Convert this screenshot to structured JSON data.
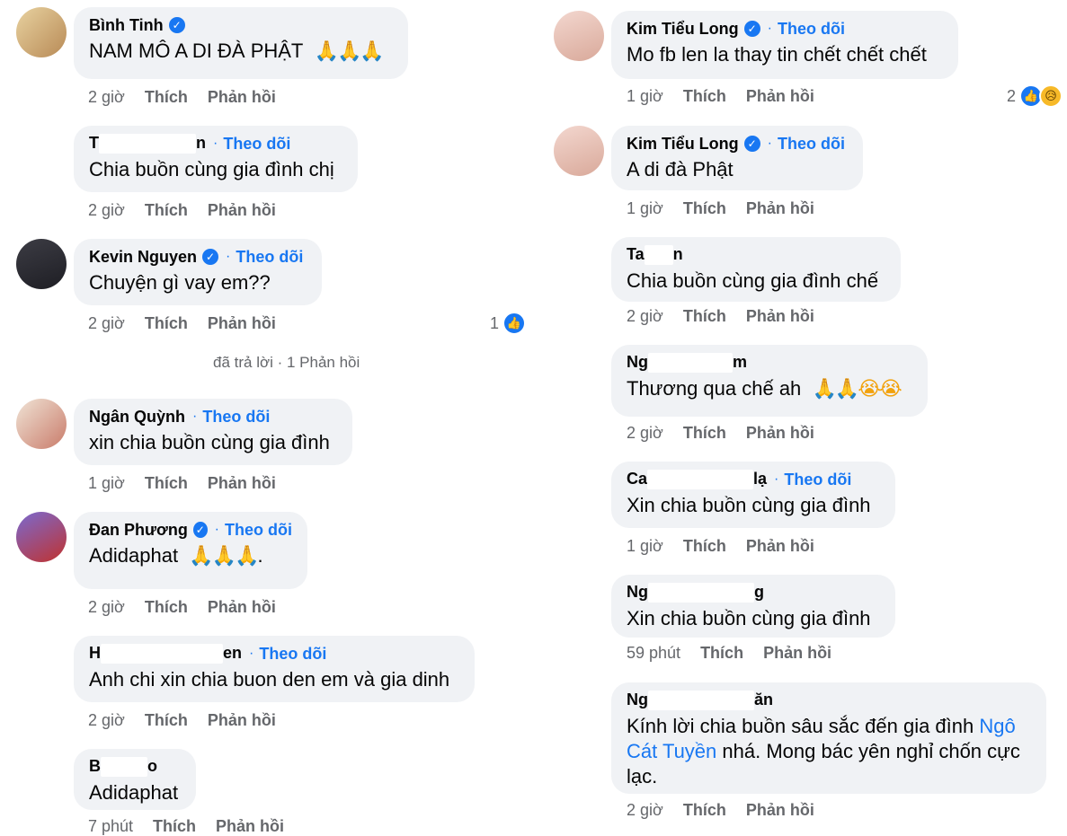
{
  "left": [
    {
      "name": "Bình Tinh",
      "verified": true,
      "follow": "",
      "text": "NAM MÔ A DI ĐÀ PHẬT",
      "emoji": "🙏🙏🙏",
      "time": "2 giờ",
      "like": "Thích",
      "reply": "Phản hồi"
    },
    {
      "name_pre": "T",
      "name_post": "n",
      "follow": "Theo dõi",
      "text": "Chia buồn cùng gia đình chị",
      "time": "2 giờ",
      "like": "Thích",
      "reply": "Phản hồi"
    },
    {
      "name": "Kevin Nguyen",
      "verified": true,
      "follow": "Theo dõi",
      "text": "Chuyện gì vay em??",
      "time": "2 giờ",
      "like": "Thích",
      "reply": "Phản hồi",
      "reaction_count": "1"
    },
    {
      "name": "Ngân Quỳnh",
      "follow": "Theo dõi",
      "text": "xin chia buồn cùng gia đình",
      "time": "1 giờ",
      "like": "Thích",
      "reply": "Phản hồi"
    },
    {
      "name": "Đan Phương",
      "verified": true,
      "follow": "Theo dõi",
      "text": "Adidaphat",
      "emoji": "🙏🙏🙏",
      "tail": ".",
      "time": "2 giờ",
      "like": "Thích",
      "reply": "Phản hồi"
    },
    {
      "name_pre": "H",
      "name_post": "en",
      "follow": "Theo dõi",
      "text": "Anh chi xin chia buon den em và gia dinh",
      "time": "2 giờ",
      "like": "Thích",
      "reply": "Phản hồi"
    },
    {
      "name_pre": "B",
      "name_post": "o",
      "text": "Adidaphat",
      "time": "7 phút",
      "like": "Thích",
      "reply": "Phản hồi"
    }
  ],
  "reply_summary": "đã trả lời · 1 Phản hồi",
  "right": [
    {
      "name": "Kim Tiểu Long",
      "verified": true,
      "follow": "Theo dõi",
      "text": "Mo fb len la thay tin chết chết chết",
      "time": "1 giờ",
      "like": "Thích",
      "reply": "Phản hồi",
      "reaction_count": "2"
    },
    {
      "name": "Kim Tiểu Long",
      "verified": true,
      "follow": "Theo dõi",
      "text": "A di đà Phật",
      "time": "1 giờ",
      "like": "Thích",
      "reply": "Phản hồi"
    },
    {
      "name_pre": "Ta",
      "name_post": "n",
      "text": "Chia buồn cùng gia đình chế",
      "time": "2 giờ",
      "like": "Thích",
      "reply": "Phản hồi"
    },
    {
      "name_pre": "Ng",
      "name_post": "m",
      "text": "Thương qua chế ah",
      "emoji": "🙏🙏😭😭",
      "time": "2 giờ",
      "like": "Thích",
      "reply": "Phản hồi"
    },
    {
      "name_pre": "Ca",
      "name_post": "lạ",
      "follow": "Theo dõi",
      "text": "Xin chia buồn cùng gia đình",
      "time": "1 giờ",
      "like": "Thích",
      "reply": "Phản hồi"
    },
    {
      "name_pre": "Ng",
      "name_post": "g",
      "text": "Xin chia buồn cùng gia đình",
      "time": "59 phút",
      "like": "Thích",
      "reply": "Phản hồi"
    },
    {
      "name_pre": "Ng",
      "name_post": "ăn",
      "text_pre": "Kính lời chia buồn sâu sắc đến gia đình ",
      "link": "Ngô Cát Tuyền",
      "text_post": " nhá. Mong bác yên nghỉ chốn cực lạc.",
      "time": "2 giờ",
      "like": "Thích",
      "reply": "Phản hồi"
    }
  ]
}
